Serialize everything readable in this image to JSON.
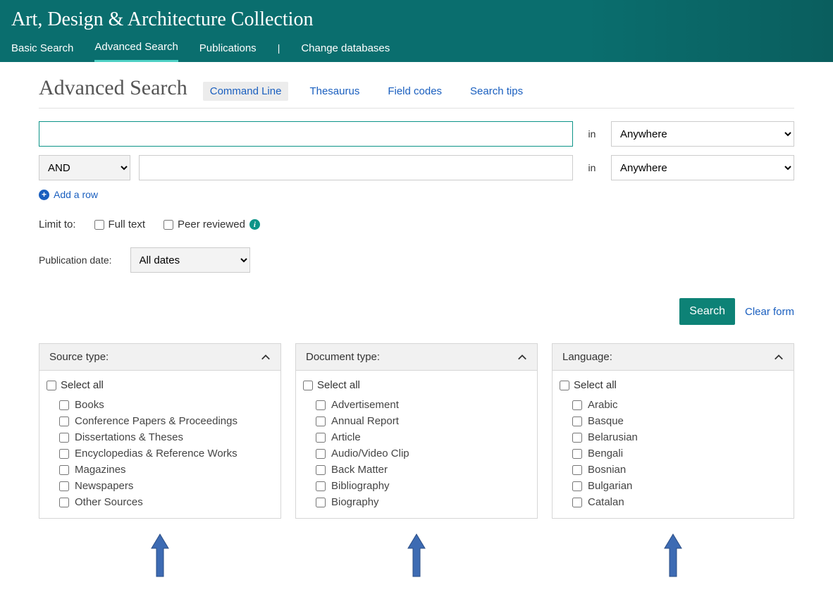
{
  "header": {
    "site_title": "Art, Design & Architecture Collection",
    "nav": {
      "basic": "Basic Search",
      "advanced": "Advanced Search",
      "publications": "Publications",
      "change_db": "Change databases"
    }
  },
  "page": {
    "title": "Advanced Search",
    "subtabs": {
      "command_line": "Command Line",
      "thesaurus": "Thesaurus",
      "field_codes": "Field codes",
      "search_tips": "Search tips"
    }
  },
  "search": {
    "row1": {
      "value": "",
      "in": "in",
      "field": "Anywhere"
    },
    "row2": {
      "operator": "AND",
      "value": "",
      "in": "in",
      "field": "Anywhere"
    },
    "add_row": "Add a row"
  },
  "limits": {
    "label": "Limit to:",
    "full_text": "Full text",
    "peer_reviewed": "Peer reviewed"
  },
  "pubdate": {
    "label": "Publication date:",
    "value": "All dates"
  },
  "actions": {
    "search": "Search",
    "clear": "Clear form"
  },
  "panels": {
    "source_type": {
      "title": "Source type:",
      "select_all": "Select all",
      "options": [
        "Books",
        "Conference Papers & Proceedings",
        "Dissertations & Theses",
        "Encyclopedias & Reference Works",
        "Magazines",
        "Newspapers",
        "Other Sources"
      ]
    },
    "document_type": {
      "title": "Document type:",
      "select_all": "Select all",
      "options": [
        "Advertisement",
        "Annual Report",
        "Article",
        "Audio/Video Clip",
        "Back Matter",
        "Bibliography",
        "Biography"
      ]
    },
    "language": {
      "title": "Language:",
      "select_all": "Select all",
      "options": [
        "Arabic",
        "Basque",
        "Belarusian",
        "Bengali",
        "Bosnian",
        "Bulgarian",
        "Catalan"
      ]
    }
  }
}
